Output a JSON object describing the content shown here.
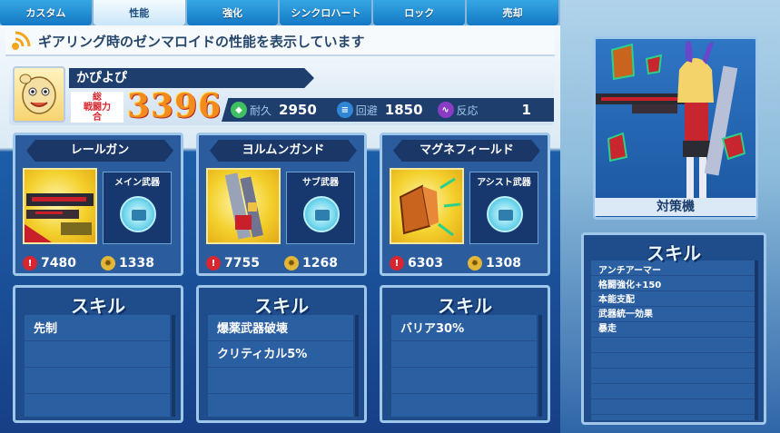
{
  "tabs": [
    {
      "label": "カスタム",
      "active": false
    },
    {
      "label": "性能",
      "active": true
    },
    {
      "label": "強化",
      "active": false
    },
    {
      "label": "シンクロハート",
      "active": false
    },
    {
      "label": "ロック",
      "active": false
    },
    {
      "label": "売却",
      "active": false
    }
  ],
  "header": {
    "text": "ギアリング時のゼンマロイドの性能を表示しています"
  },
  "player": {
    "name": "かぴよぴ",
    "power_label_line1": "総",
    "power_label_line2": "戦闘力",
    "power_label_suffix": "合",
    "power_value": "3396"
  },
  "stats": {
    "durability": {
      "label": "耐久",
      "value": "2950"
    },
    "evasion": {
      "label": "回避",
      "value": "1850"
    },
    "reaction": {
      "label": "反応",
      "value": "1"
    }
  },
  "weapons": [
    {
      "name": "レールガン",
      "slot": "メイン武器",
      "attack": "7480",
      "defense": "1338"
    },
    {
      "name": "ヨルムンガンド",
      "slot": "サブ武器",
      "attack": "7755",
      "defense": "1268"
    },
    {
      "name": "マグネフィールド",
      "slot": "アシスト武器",
      "attack": "6303",
      "defense": "1308"
    }
  ],
  "skill_title": "スキル",
  "weapon_skills": [
    [
      "先制"
    ],
    [
      "爆薬武器破壊",
      "クリティカル5%"
    ],
    [
      "バリア30%"
    ]
  ],
  "character": {
    "type_label": "対策機",
    "skills": [
      "アンチアーマー",
      "格闘強化+150",
      "本能支配",
      "武器統一効果",
      "暴走"
    ]
  },
  "colors": {
    "tab_active": "#e2f1fb",
    "tab_inactive": "#1b88d4",
    "panel_dark": "#1e3e6e",
    "power_orange": "#f38b1d",
    "attack_red": "#d7262f",
    "defense_gold": "#e2b637"
  },
  "icons": {
    "header": "signal-icon",
    "durability": "shield-icon",
    "evasion": "dash-icon",
    "reaction": "pulse-icon",
    "attack": "attack-icon",
    "defense": "gear-icon",
    "slot": "gun-icon"
  }
}
